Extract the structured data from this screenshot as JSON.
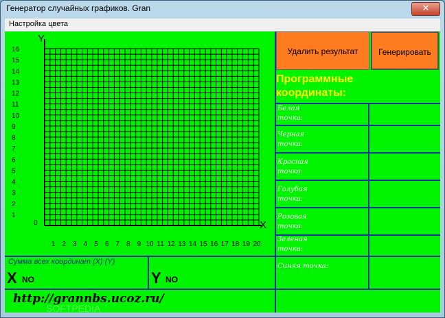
{
  "window": {
    "title": "Генератор случайных графиков. Gran",
    "close_label": "✕"
  },
  "menu": {
    "items": [
      "Настройка цвета"
    ]
  },
  "buttons": {
    "delete": "Удалить результат",
    "generate": "Генерировать"
  },
  "heading": {
    "line1": "Программные",
    "line2": "координаты:"
  },
  "coords": [
    {
      "line1": "Белая",
      "line2": "точка:"
    },
    {
      "line1": "Черная",
      "line2": "точка:"
    },
    {
      "line1": "Красная",
      "line2": "точка:"
    },
    {
      "line1": "Голубая",
      "line2": "точка:"
    },
    {
      "line1": "Розовая",
      "line2": "точка:"
    },
    {
      "line1": "Зеленая",
      "line2": "точка:"
    },
    {
      "line1": "Синяя точка:",
      "line2": ""
    }
  ],
  "graph": {
    "y_axis_label": "Y",
    "x_axis_label": "X",
    "origin_label": "0",
    "y_ticks": [
      "1",
      "2",
      "3",
      "4",
      "5",
      "6",
      "7",
      "8",
      "9",
      "10",
      "11",
      "12",
      "13",
      "14",
      "15",
      "16"
    ],
    "x_ticks": [
      "1",
      "2",
      "3",
      "4",
      "5",
      "6",
      "7",
      "8",
      "9",
      "10",
      "11",
      "12",
      "13",
      "14",
      "15",
      "16",
      "17",
      "18",
      "19",
      "20"
    ]
  },
  "summary": {
    "label": "Сумма всех координат (X) (Y)",
    "x_letter": "X",
    "x_value": "NO",
    "y_letter": "Y",
    "y_value": "NO"
  },
  "url": "http://grannbs.ucoz.ru/",
  "watermark": "SOFTPEDIA",
  "colors": {
    "background": "#00f400",
    "grid": "#000000",
    "table_lines": "#1a2fa0",
    "button": "#ff7b20",
    "heading": "#ffff00"
  }
}
